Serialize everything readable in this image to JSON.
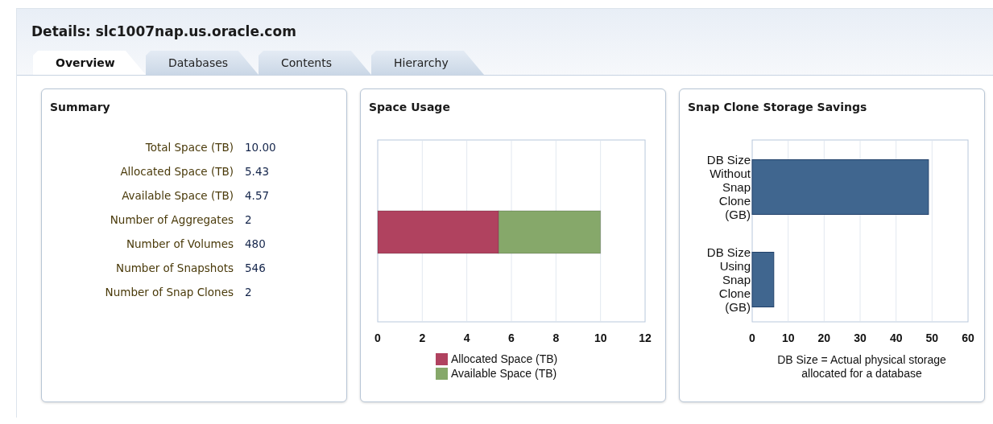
{
  "title": "Details: slc1007nap.us.oracle.com",
  "tabs": [
    {
      "label": "Overview",
      "selected": true
    },
    {
      "label": "Databases",
      "selected": false
    },
    {
      "label": "Contents",
      "selected": false
    },
    {
      "label": "Hierarchy",
      "selected": false
    }
  ],
  "summary": {
    "title": "Summary",
    "rows": [
      {
        "label": "Total Space (TB)",
        "value": "10.00"
      },
      {
        "label": "Allocated Space (TB)",
        "value": "5.43"
      },
      {
        "label": "Available Space (TB)",
        "value": "4.57"
      },
      {
        "label": "Number of Aggregates",
        "value": "2"
      },
      {
        "label": "Number of Volumes",
        "value": "480"
      },
      {
        "label": "Number of Snapshots",
        "value": "546"
      },
      {
        "label": "Number of Snap Clones",
        "value": "2"
      }
    ]
  },
  "space_usage": {
    "title": "Space Usage",
    "chart_data": {
      "type": "bar",
      "orientation": "horizontal",
      "stacked": true,
      "grid": true,
      "legend": true,
      "xlim": [
        0,
        12
      ],
      "xticks": [
        0,
        2,
        4,
        6,
        8,
        10,
        12
      ],
      "series": [
        {
          "name": "Allocated Space (TB)",
          "color": "#b0425f",
          "values": [
            5.43
          ]
        },
        {
          "name": "Available Space (TB)",
          "color": "#86a86a",
          "values": [
            4.57
          ]
        }
      ]
    }
  },
  "snap_clone": {
    "title": "Snap Clone Storage Savings",
    "chart_data": {
      "type": "bar",
      "orientation": "horizontal",
      "grid": true,
      "xlim": [
        0,
        60
      ],
      "xticks": [
        0,
        10,
        20,
        30,
        40,
        50,
        60
      ],
      "xlabel": "DB Size = Actual physical storage allocated for a database",
      "categories": [
        "DB Size Without Snap Clone (GB)",
        "DB Size Using Snap Clone (GB)"
      ],
      "series": [
        {
          "color": "#40668f",
          "values": [
            49,
            6
          ]
        }
      ]
    }
  }
}
